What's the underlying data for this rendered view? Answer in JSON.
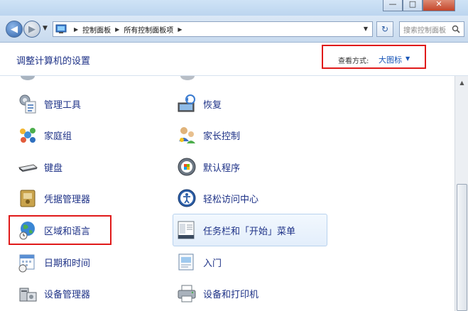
{
  "window": {
    "buttons": {
      "minimize": "—",
      "maximize": "□",
      "close": "✕"
    }
  },
  "nav": {
    "back_icon": "back-arrow",
    "forward_icon": "forward-arrow",
    "address": [
      "控制面板",
      "所有控制面板项"
    ],
    "search_placeholder": "搜索控制面板"
  },
  "header": {
    "title": "调整计算机的设置",
    "view_label": "查看方式:",
    "view_value": "大图标"
  },
  "items": {
    "left": [
      "管理工具",
      "家庭组",
      "键盘",
      "凭据管理器",
      "区域和语言",
      "日期和时间",
      "设备管理器"
    ],
    "right": [
      "恢复",
      "家长控制",
      "默认程序",
      "轻松访问中心",
      "任务栏和「开始」菜单",
      "入门",
      "设备和打印机"
    ]
  },
  "colors": {
    "link": "#1e3287",
    "highlight_border": "#e01a1a",
    "view_value": "#1a57b8"
  }
}
